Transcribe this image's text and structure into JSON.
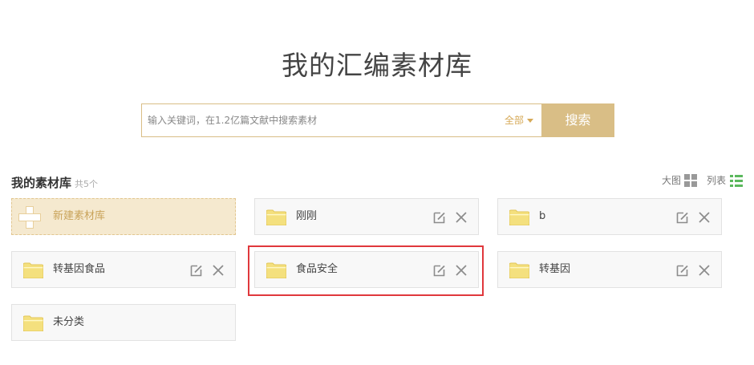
{
  "page": {
    "title": "我的汇编素材库"
  },
  "search": {
    "placeholder": "输入关键词，在1.2亿篇文献中搜索素材",
    "value": "",
    "scope_label": "全部",
    "button_label": "搜索"
  },
  "library": {
    "heading": "我的素材库",
    "count_label": "共5个",
    "view_grid_label": "大图",
    "view_list_label": "列表",
    "new_label": "新建素材库",
    "items": [
      {
        "name": "刚刚"
      },
      {
        "name": "b"
      },
      {
        "name": "转基因食品"
      },
      {
        "name": "食品安全"
      },
      {
        "name": "转基因"
      },
      {
        "name": "未分类"
      }
    ]
  },
  "colors": {
    "accent": "#d9be86",
    "new_card_bg": "#f5e9cf",
    "folder": "#f4e07e",
    "highlight": "#e0383c",
    "list_icon": "#5bb85d"
  }
}
